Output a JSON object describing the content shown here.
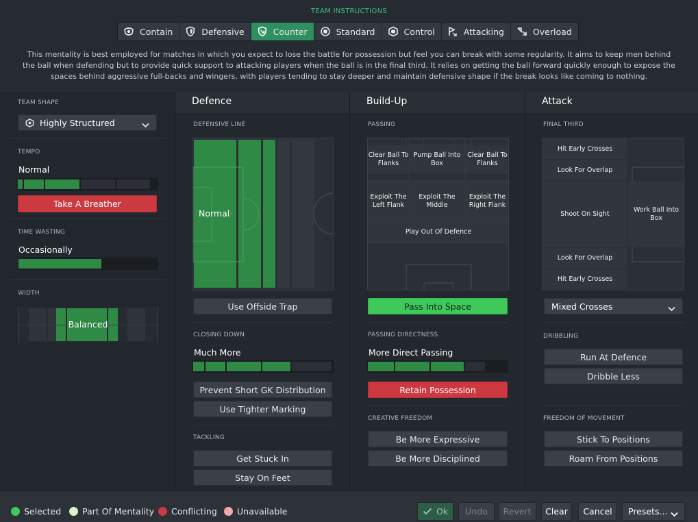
{
  "header": {
    "title": "TEAM INSTRUCTIONS",
    "mentalities": [
      {
        "label": "Contain",
        "icon": "contain-icon",
        "selected": false
      },
      {
        "label": "Defensive",
        "icon": "shield-icon",
        "selected": false
      },
      {
        "label": "Counter",
        "icon": "counter-icon",
        "selected": true
      },
      {
        "label": "Standard",
        "icon": "standard-icon",
        "selected": false
      },
      {
        "label": "Control",
        "icon": "control-icon",
        "selected": false
      },
      {
        "label": "Attacking",
        "icon": "attacking-icon",
        "selected": false
      },
      {
        "label": "Overload",
        "icon": "overload-icon",
        "selected": false
      }
    ],
    "description": "This mentality is best employed for matches in which you expect to lose the battle for possession but feel you can break with some regularity.  It aims to keep men behind the ball when defending but to provide quick support to attacking players when the ball is in the final third. It relies on getting the ball forward quickly enough to expose the spaces behind aggressive full-backs and wingers, with players tending to stay deeper and maintain defensive shape if the break looks like coming to nothing."
  },
  "left": {
    "team_shape_label": "TEAM SHAPE",
    "team_shape_value": "Highly Structured",
    "tempo_label": "TEMPO",
    "tempo_value": "Normal",
    "tempo_button": "Take A Breather",
    "time_wasting_label": "TIME WASTING",
    "time_wasting_value": "Occasionally",
    "width_label": "WIDTH",
    "width_value": "Balanced"
  },
  "defence": {
    "title": "Defence",
    "line_label": "DEFENSIVE LINE",
    "line_value": "Normal",
    "offside_button": "Use Offside Trap",
    "closing_label": "CLOSING DOWN",
    "closing_value": "Much More",
    "gk_button": "Prevent Short GK Distribution",
    "marking_button": "Use Tighter Marking",
    "tackling_label": "TACKLING",
    "stuck_button": "Get Stuck In",
    "feet_button": "Stay On Feet"
  },
  "buildup": {
    "title": "Build-Up",
    "passing_label": "PASSING",
    "zones": {
      "clear_left": "Clear Ball To Flanks",
      "pump": "Pump Ball Into Box",
      "clear_right": "Clear Ball To Flanks",
      "exploit_left": "Exploit The Left Flank",
      "exploit_middle": "Exploit The Middle",
      "exploit_right": "Exploit The Right Flank",
      "play_out": "Play Out Of Defence"
    },
    "pass_space_button": "Pass Into Space",
    "directness_label": "PASSING DIRECTNESS",
    "directness_value": "More Direct Passing",
    "retain_button": "Retain Possession",
    "creative_label": "CREATIVE FREEDOM",
    "expressive_button": "Be More Expressive",
    "disciplined_button": "Be More Disciplined"
  },
  "attack": {
    "title": "Attack",
    "final_third_label": "FINAL THIRD",
    "zones": {
      "crosses_top": "Hit Early Crosses",
      "overlap_top": "Look For Overlap",
      "shoot": "Shoot On Sight",
      "work_ball": "Work Ball Into Box",
      "overlap_bottom": "Look For Overlap",
      "crosses_bottom": "Hit Early Crosses"
    },
    "crosses_dropdown": "Mixed Crosses",
    "dribbling_label": "DRIBBLING",
    "run_button": "Run At Defence",
    "dribble_less_button": "Dribble Less",
    "movement_label": "FREEDOM OF MOVEMENT",
    "stick_button": "Stick To Positions",
    "roam_button": "Roam From Positions"
  },
  "footer": {
    "legend": [
      {
        "label": "Selected",
        "color": "#3fc95a"
      },
      {
        "label": "Part Of Mentality",
        "color": "#d8f4c8"
      },
      {
        "label": "Conflicting",
        "color": "#cc3940"
      },
      {
        "label": "Unavailable",
        "color": "#f0a8ae"
      }
    ],
    "ok": "Ok",
    "undo": "Undo",
    "revert": "Revert",
    "clear": "Clear",
    "cancel": "Cancel",
    "presets": "Presets..."
  },
  "colors": {
    "accent": "#2f8f61",
    "green": "#3fc95a",
    "red": "#cc3940",
    "bar_on": "#2f8a45"
  }
}
